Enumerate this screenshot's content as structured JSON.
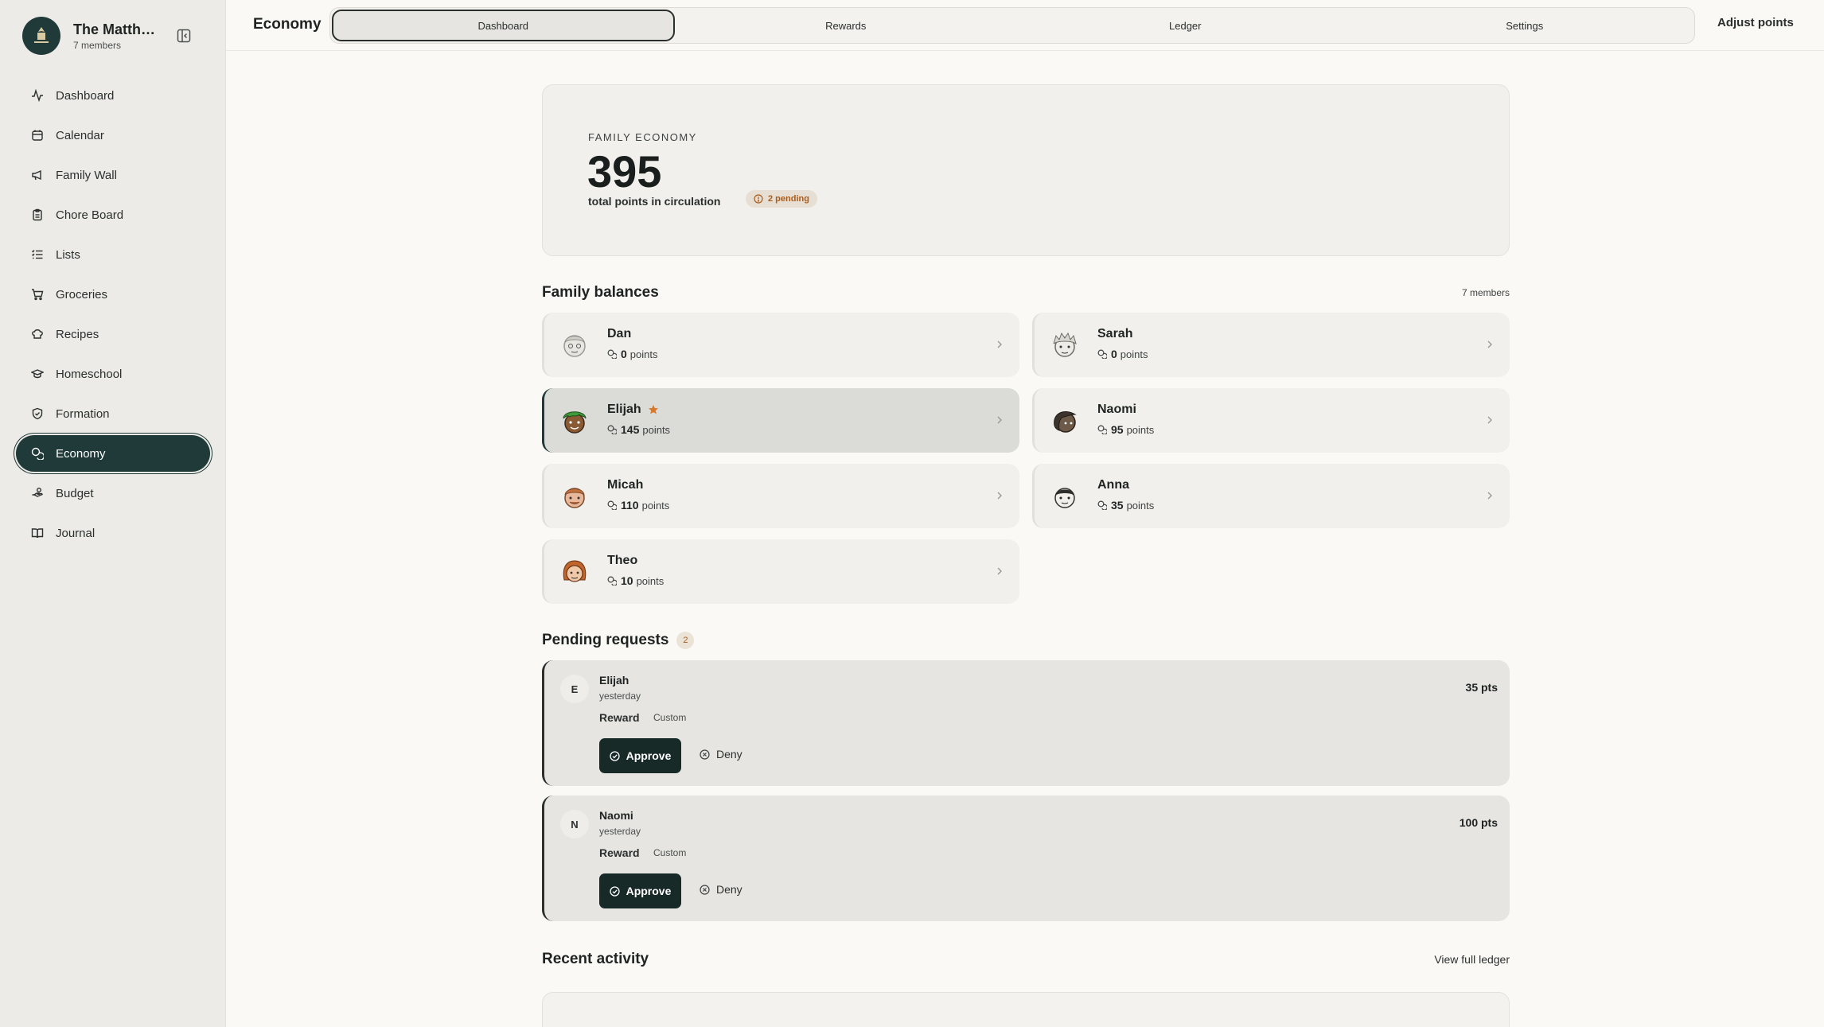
{
  "family": {
    "name": "The Matthe…",
    "members_label": "7 members"
  },
  "nav": [
    {
      "label": "Dashboard",
      "icon": "activity-icon"
    },
    {
      "label": "Calendar",
      "icon": "calendar-icon"
    },
    {
      "label": "Family Wall",
      "icon": "megaphone-icon"
    },
    {
      "label": "Chore Board",
      "icon": "clipboard-icon"
    },
    {
      "label": "Lists",
      "icon": "list-icon"
    },
    {
      "label": "Groceries",
      "icon": "cart-icon"
    },
    {
      "label": "Recipes",
      "icon": "chef-hat-icon"
    },
    {
      "label": "Homeschool",
      "icon": "graduation-cap-icon"
    },
    {
      "label": "Formation",
      "icon": "shield-icon"
    },
    {
      "label": "Economy",
      "icon": "coins-icon",
      "active": true
    },
    {
      "label": "Budget",
      "icon": "hand-coins-icon"
    },
    {
      "label": "Journal",
      "icon": "book-icon"
    }
  ],
  "header": {
    "title": "Economy",
    "tabs": [
      "Dashboard",
      "Rewards",
      "Ledger",
      "Settings"
    ],
    "active_tab": "Dashboard",
    "adjust_label": "Adjust points"
  },
  "economy": {
    "label": "FAMILY ECONOMY",
    "total": "395",
    "subtitle": "total points in circulation",
    "pending_label": "2 pending"
  },
  "balances": {
    "title": "Family balances",
    "count_label": "7 members",
    "points_unit": "points",
    "members": [
      {
        "name": "Dan",
        "points": "0"
      },
      {
        "name": "Sarah",
        "points": "0"
      },
      {
        "name": "Elijah",
        "points": "145",
        "top": true
      },
      {
        "name": "Naomi",
        "points": "95"
      },
      {
        "name": "Micah",
        "points": "110"
      },
      {
        "name": "Anna",
        "points": "35"
      },
      {
        "name": "Theo",
        "points": "10"
      }
    ]
  },
  "pending": {
    "title": "Pending requests",
    "count": "2",
    "approve_label": "Approve",
    "deny_label": "Deny",
    "requests": [
      {
        "initial": "E",
        "name": "Elijah",
        "time": "yesterday",
        "type": "Reward",
        "tag": "Custom",
        "points": "35 pts"
      },
      {
        "initial": "N",
        "name": "Naomi",
        "time": "yesterday",
        "type": "Reward",
        "tag": "Custom",
        "points": "100 pts"
      }
    ]
  },
  "recent": {
    "title": "Recent activity",
    "link": "View full ledger"
  },
  "colors": {
    "accent": "#1f3a38",
    "pending": "#a95c1c",
    "star": "#d9782a"
  }
}
